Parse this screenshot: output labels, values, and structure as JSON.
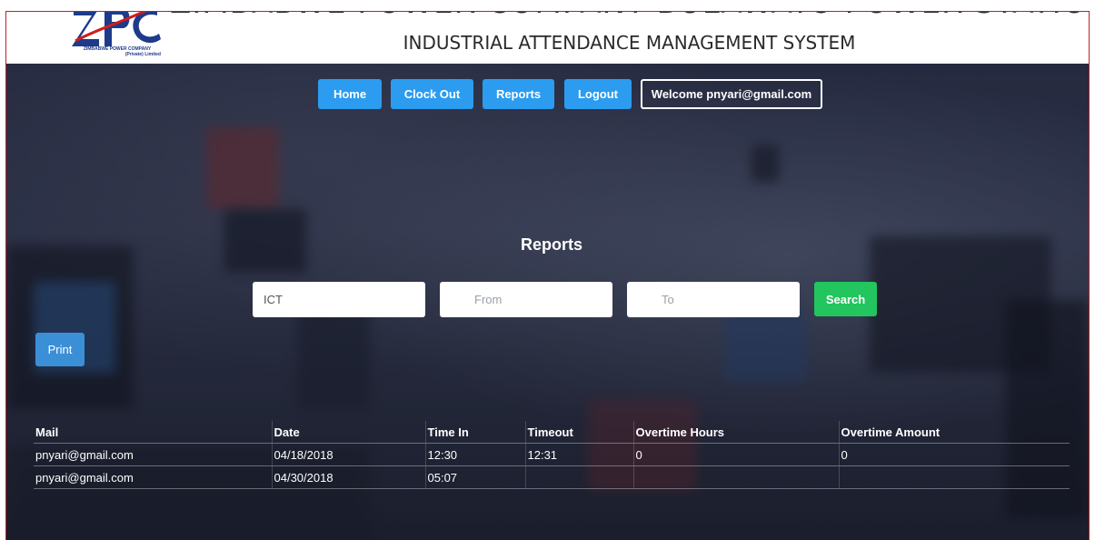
{
  "header": {
    "logo_company_line1": "ZIMBABWE POWER COMPANY",
    "logo_company_line2": "(Private) Limited",
    "company_title": "ZIMBABWE POWER COMPANY BULAWAYO POWER STATION",
    "system_title": "INDUSTRIAL ATTENDANCE MANAGEMENT SYSTEM"
  },
  "nav": {
    "home_label": "Home",
    "clockout_label": "Clock Out",
    "reports_label": "Reports",
    "logout_label": "Logout",
    "welcome_text": "Welcome pnyari@gmail.com"
  },
  "main": {
    "page_title": "Reports",
    "department_value": "ICT",
    "from_placeholder": "From",
    "to_placeholder": "To",
    "search_label": "Search",
    "print_label": "Print"
  },
  "table": {
    "headers": [
      "Mail",
      "Date",
      "Time In",
      "Timeout",
      "Overtime Hours",
      "Overtime Amount"
    ],
    "rows": [
      [
        "pnyari@gmail.com",
        "04/18/2018",
        "12:30",
        "12:31",
        "0",
        "0"
      ],
      [
        "pnyari@gmail.com",
        "04/30/2018",
        "05:07",
        "",
        "",
        ""
      ]
    ]
  },
  "colors": {
    "nav_button": "#2b9cf0",
    "search_button": "#22c55e",
    "print_button": "#3a8fd6",
    "logo_blue": "#1e3a8a",
    "logo_red": "#d01c1c"
  }
}
